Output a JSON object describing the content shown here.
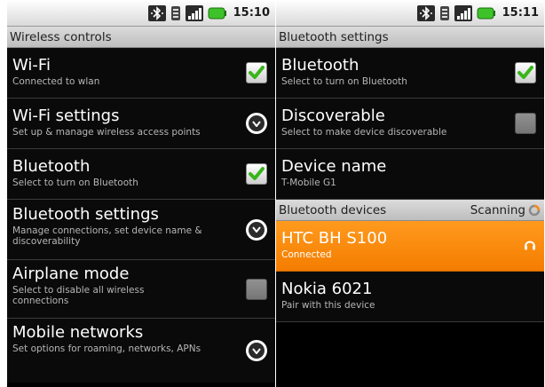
{
  "left": {
    "status_time": "15:10",
    "header": "Wireless controls",
    "items": [
      {
        "title": "Wi-Fi",
        "subtitle": "Connected to wlan",
        "control": "checkbox",
        "checked": true
      },
      {
        "title": "Wi-Fi settings",
        "subtitle": "Set up & manage wireless access points",
        "control": "arrow"
      },
      {
        "title": "Bluetooth",
        "subtitle": "Select to turn on Bluetooth",
        "control": "checkbox",
        "checked": true
      },
      {
        "title": "Bluetooth settings",
        "subtitle": "Manage connections, set device name & discoverability",
        "control": "arrow"
      },
      {
        "title": "Airplane mode",
        "subtitle": "Select to disable all wireless connections",
        "control": "checkbox",
        "checked": false
      },
      {
        "title": "Mobile networks",
        "subtitle": "Set options for roaming, networks, APNs",
        "control": "arrow"
      }
    ]
  },
  "right": {
    "status_time": "15:11",
    "header": "Bluetooth settings",
    "items": [
      {
        "title": "Bluetooth",
        "subtitle": "Select to turn on Bluetooth",
        "control": "checkbox",
        "checked": true
      },
      {
        "title": "Discoverable",
        "subtitle": "Select to make device discoverable",
        "control": "checkbox",
        "checked": false
      },
      {
        "title": "Device name",
        "subtitle": "T-Mobile G1"
      }
    ],
    "devices_header": "Bluetooth devices",
    "scanning_label": "Scanning",
    "devices": [
      {
        "title": "HTC BH S100",
        "subtitle": "Connected",
        "icon": "headset-icon",
        "highlighted": true
      },
      {
        "title": "Nokia 6021",
        "subtitle": "Pair with this device",
        "highlighted": false
      }
    ]
  },
  "colors": {
    "background": "#000000",
    "highlight": "#f88a10",
    "check_green": "#39b51a",
    "status_battery": "#3ec22a"
  },
  "icons": {
    "status": [
      "bluetooth-icon",
      "data-icon",
      "signal-icon",
      "battery-icon"
    ]
  }
}
